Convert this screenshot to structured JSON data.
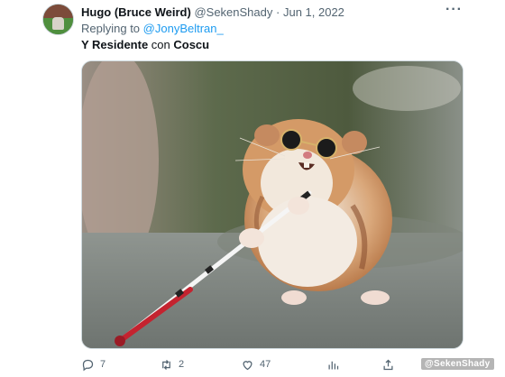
{
  "tweet": {
    "author_name": "Hugo (Bruce Weird)",
    "author_handle": "@SekenShady",
    "separator": "·",
    "date": "Jun 1, 2022",
    "replying_prefix": "Replying to ",
    "replying_handle": "@JonyBeltran_",
    "text_bold_1": "Y Residente",
    "text_normal": " con ",
    "text_bold_2": "Coscu",
    "more_icon": "more-dots-icon",
    "media_description_icon": "hamster-with-sunglasses-and-cane-photo"
  },
  "actions": {
    "replies": "7",
    "retweets": "2",
    "likes": "47",
    "views": "",
    "icons": [
      "reply-icon",
      "retweet-icon",
      "like-icon",
      "views-icon",
      "share-icon"
    ]
  },
  "watermark": "@SekenShady",
  "colors": {
    "link": "#1d9bf0",
    "secondary_text": "#536471",
    "primary_text": "#0f1419"
  }
}
